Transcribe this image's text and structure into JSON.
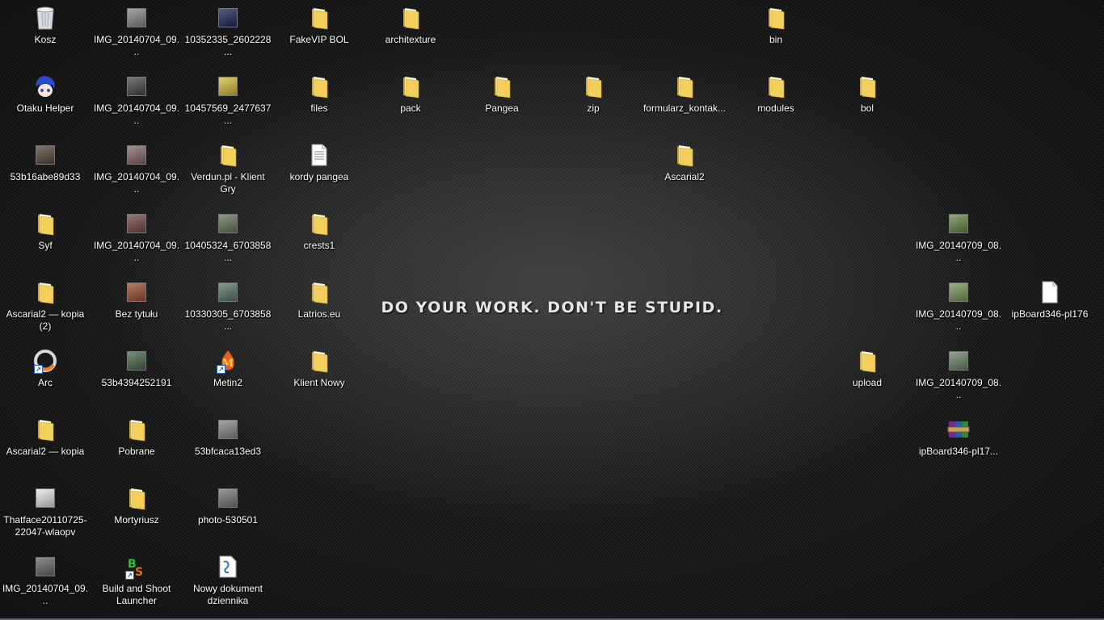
{
  "wallpaper": {
    "slogan": "DO YOUR WORK. DON'T BE STUPID."
  },
  "icons": [
    {
      "label": "Kosz",
      "kind": "recycle-bin-icon",
      "icon": "trash"
    },
    {
      "label": "IMG_20140704_09...",
      "kind": "image-thumbnail-icon",
      "icon": "photo",
      "color": "#8a8a8a"
    },
    {
      "label": "10352335_2602228...",
      "kind": "image-thumbnail-icon",
      "icon": "photo",
      "color": "#1a2a5a"
    },
    {
      "label": "FakeVIP BOL",
      "kind": "folder-icon",
      "icon": "folder"
    },
    {
      "label": "architexture",
      "kind": "folder-icon",
      "icon": "folder"
    },
    {
      "label": "bin",
      "kind": "folder-icon",
      "icon": "folder"
    },
    {
      "label": "Otaku Helper",
      "kind": "app-icon",
      "icon": "otaku"
    },
    {
      "label": "IMG_20140704_09...",
      "kind": "image-thumbnail-icon",
      "icon": "photo",
      "color": "#4a4a4a"
    },
    {
      "label": "10457569_2477637...",
      "kind": "image-thumbnail-icon",
      "icon": "photo",
      "color": "#d8c040"
    },
    {
      "label": "files",
      "kind": "folder-icon",
      "icon": "folder"
    },
    {
      "label": "pack",
      "kind": "folder-icon",
      "icon": "folder"
    },
    {
      "label": "Pangea",
      "kind": "folder-icon",
      "icon": "folder"
    },
    {
      "label": "zip",
      "kind": "folder-icon",
      "icon": "folder"
    },
    {
      "label": "formularz_kontak...",
      "kind": "folder-icon",
      "icon": "folder"
    },
    {
      "label": "modules",
      "kind": "folder-icon",
      "icon": "folder"
    },
    {
      "label": "bol",
      "kind": "folder-icon",
      "icon": "folder"
    },
    {
      "label": "53b16abe89d33",
      "kind": "image-thumbnail-icon",
      "icon": "photo",
      "color": "#5a4a3a"
    },
    {
      "label": "IMG_20140704_09...",
      "kind": "image-thumbnail-icon",
      "icon": "photo",
      "color": "#8a6a6a"
    },
    {
      "label": "Verdun.pl - Klient Gry",
      "kind": "folder-icon",
      "icon": "folder"
    },
    {
      "label": "kordy pangea",
      "kind": "text-document-icon",
      "icon": "doc"
    },
    {
      "label": "Ascarial2",
      "kind": "folder-icon",
      "icon": "folder"
    },
    {
      "label": "Syf",
      "kind": "folder-icon",
      "icon": "folder"
    },
    {
      "label": "IMG_20140704_09...",
      "kind": "image-thumbnail-icon",
      "icon": "photo",
      "color": "#7a4a4a"
    },
    {
      "label": "10405324_6703858...",
      "kind": "image-thumbnail-icon",
      "icon": "photo",
      "color": "#6a7a5a"
    },
    {
      "label": "crests1",
      "kind": "folder-icon",
      "icon": "folder"
    },
    {
      "label": "IMG_20140709_08...",
      "kind": "image-thumbnail-icon",
      "icon": "photo",
      "color": "#6a8a4a"
    },
    {
      "label": "Ascarial2 — kopia (2)",
      "kind": "folder-icon",
      "icon": "folder"
    },
    {
      "label": "Bez tytułu",
      "kind": "image-thumbnail-icon",
      "icon": "photo",
      "color": "#a05030"
    },
    {
      "label": "10330305_6703858...",
      "kind": "image-thumbnail-icon",
      "icon": "photo",
      "color": "#5a7a6a"
    },
    {
      "label": "Latrios.eu",
      "kind": "folder-icon",
      "icon": "folder"
    },
    {
      "label": "IMG_20140709_08...",
      "kind": "image-thumbnail-icon",
      "icon": "photo",
      "color": "#7a9a5a"
    },
    {
      "label": "ipBoard346-pl176",
      "kind": "blank-file-icon",
      "icon": "file"
    },
    {
      "label": "Arc",
      "kind": "app-shortcut-icon",
      "icon": "arc"
    },
    {
      "label": "53b4394252191",
      "kind": "image-thumbnail-icon",
      "icon": "photo",
      "color": "#4a6a4a"
    },
    {
      "label": "Metin2",
      "kind": "app-shortcut-icon",
      "icon": "metin"
    },
    {
      "label": "Klient Nowy",
      "kind": "folder-icon",
      "icon": "folder"
    },
    {
      "label": "upload",
      "kind": "folder-icon",
      "icon": "folder"
    },
    {
      "label": "IMG_20140709_08...",
      "kind": "image-thumbnail-icon",
      "icon": "photo",
      "color": "#6a8a6a"
    },
    {
      "label": "Ascarial2 — kopia",
      "kind": "folder-icon",
      "icon": "folder"
    },
    {
      "label": "Pobrane",
      "kind": "folder-icon",
      "icon": "folder"
    },
    {
      "label": "53bfcaca13ed3",
      "kind": "image-thumbnail-icon",
      "icon": "photo",
      "color": "#8a8a8a"
    },
    {
      "label": "ipBoard346-pl17...",
      "kind": "archive-icon",
      "icon": "rar"
    },
    {
      "label": "Thatface20110725-22047-wlaopv",
      "kind": "image-thumbnail-icon",
      "icon": "photo",
      "color": "#e8e8e8"
    },
    {
      "label": "Mortyriusz",
      "kind": "folder-icon",
      "icon": "folder"
    },
    {
      "label": "photo-530501",
      "kind": "image-thumbnail-icon",
      "icon": "photo",
      "color": "#7a7a7a"
    },
    {
      "label": "IMG_20140704_09...",
      "kind": "image-thumbnail-icon",
      "icon": "photo",
      "color": "#6a6a6a"
    },
    {
      "label": "Build and Shoot Launcher",
      "kind": "app-shortcut-icon",
      "icon": "bs"
    },
    {
      "label": "Nowy dokument dziennika",
      "kind": "journal-document-icon",
      "icon": "journal"
    }
  ]
}
